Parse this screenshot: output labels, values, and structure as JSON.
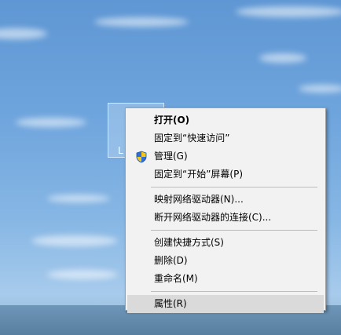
{
  "desktop": {
    "icon_caption": "L"
  },
  "context_menu": {
    "items": [
      {
        "label": "打开(O)",
        "bold": true
      },
      {
        "label": "固定到“快速访问”"
      },
      {
        "label": "管理(G)",
        "icon": "uac-shield-icon"
      },
      {
        "label": "固定到“开始”屏幕(P)"
      },
      {
        "label": "映射网络驱动器(N)..."
      },
      {
        "label": "断开网络驱动器的连接(C)..."
      },
      {
        "label": "创建快捷方式(S)"
      },
      {
        "label": "删除(D)"
      },
      {
        "label": "重命名(M)"
      },
      {
        "label": "属性(R)",
        "highlighted": true
      }
    ]
  }
}
